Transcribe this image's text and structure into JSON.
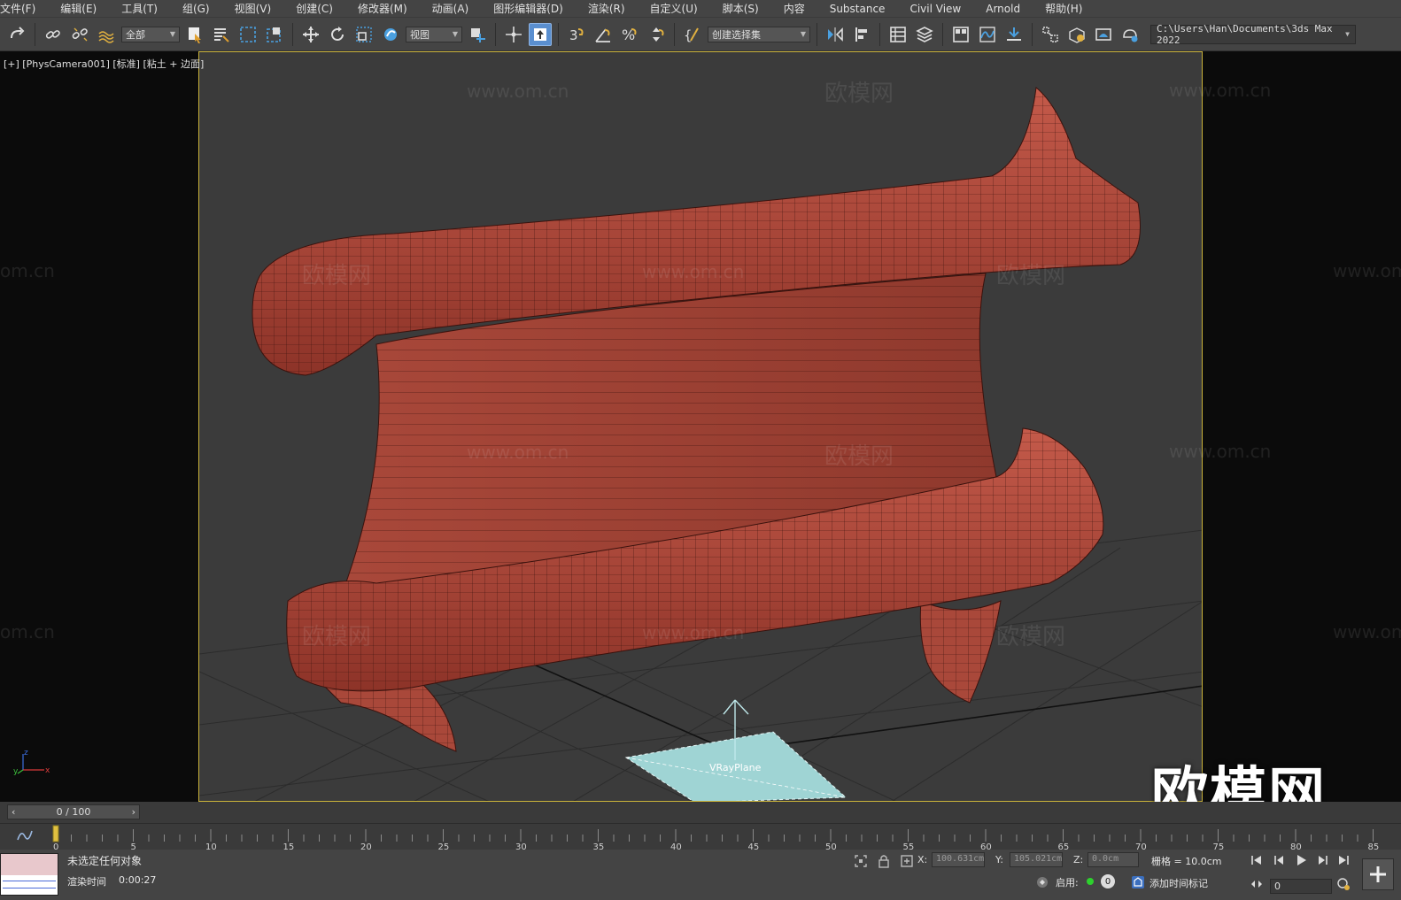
{
  "menu": {
    "items": [
      "文件(F)",
      "编辑(E)",
      "工具(T)",
      "组(G)",
      "视图(V)",
      "创建(C)",
      "修改器(M)",
      "动画(A)",
      "图形编辑器(D)",
      "渲染(R)",
      "自定义(U)",
      "脚本(S)",
      "内容",
      "Substance",
      "Civil View",
      "Arnold",
      "帮助(H)"
    ]
  },
  "toolbar": {
    "selection_filter": "全部",
    "reference_coord": "视图",
    "named_selection": "创建选择集",
    "project_path": "C:\\Users\\Han\\Documents\\3ds Max 2022"
  },
  "viewport": {
    "label": "[+] [PhysCamera001] [标准] [粘土 + 边面]",
    "watermark_logo": "欧模网",
    "watermark_url": "www.om.cn",
    "watermark_partial": "om.cn",
    "helper_label": "VRayPlane",
    "big_logo": "欧模网",
    "axis": {
      "z": "z",
      "y": "y",
      "x": "x"
    }
  },
  "timeline": {
    "current": "0 / 100",
    "ticks": [
      "0",
      "5",
      "10",
      "15",
      "20",
      "25",
      "30",
      "35",
      "40",
      "45",
      "50",
      "55",
      "60",
      "65",
      "70",
      "75",
      "80",
      "85"
    ]
  },
  "status": {
    "selection": "未选定任何对象",
    "render_time_label": "渲染时间",
    "render_time_value": "0:00:27",
    "x_label": "X:",
    "x_value": "100.631cm",
    "y_label": "Y:",
    "y_value": "105.021cm",
    "z_label": "Z:",
    "z_value": "0.0cm",
    "grid": "栅格 = 10.0cm",
    "enable_label": "启用:",
    "enable_count": "0",
    "add_time_tag": "添加时间标记",
    "frame_value": "0"
  },
  "colors": {
    "model": "#b24a3c",
    "wire": "#3a120d",
    "viewport_bg": "#3b3b3b",
    "safe_frame": "#c9b23a",
    "vray_plane": "#9fd4d4"
  }
}
